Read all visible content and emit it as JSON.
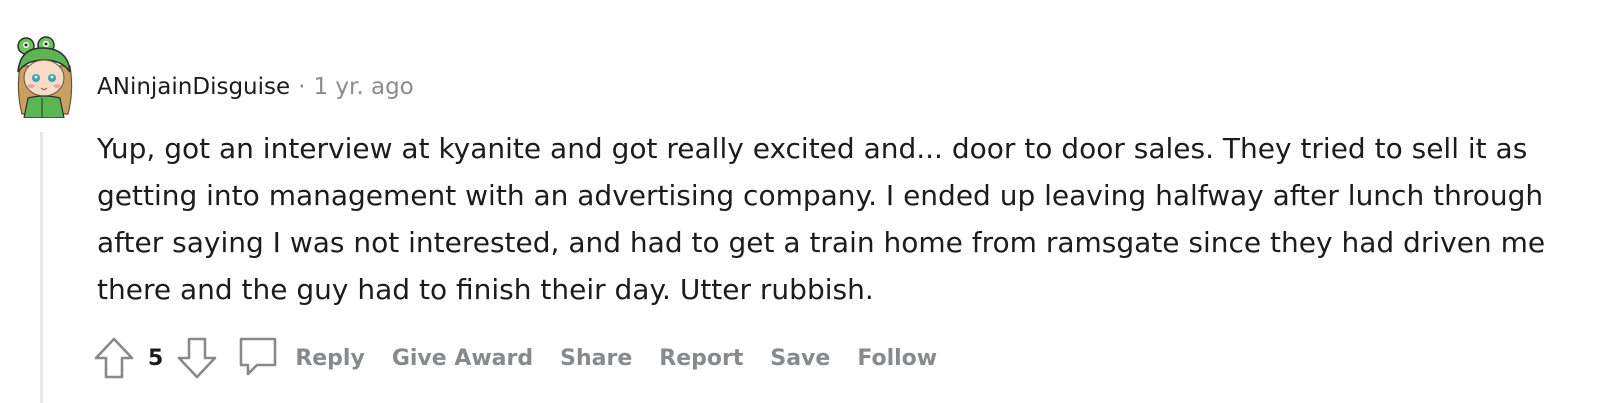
{
  "comment": {
    "author": "ANinjainDisguise",
    "separator": "·",
    "time": "1 yr. ago",
    "body": "Yup, got an interview at kyanite and got really excited and... door to door sales. They tried to sell it as getting into management with an advertising company. I ended up leaving halfway after lunch through after saying I was not interested, and had to get a train home from ramsgate since they had driven me there and the guy had to finish their day. Utter rubbish.",
    "score": "5"
  },
  "actions": {
    "reply": "Reply",
    "give_award": "Give Award",
    "share": "Share",
    "report": "Report",
    "save": "Save",
    "follow": "Follow"
  },
  "icons": {
    "upvote": "arrow-up-outline-icon",
    "downvote": "arrow-down-outline-icon",
    "reply": "speech-bubble-icon"
  },
  "colors": {
    "text": "#1c1c1c",
    "muted": "#878a8c",
    "thread_line": "#e8e8e8",
    "avatar_green": "#5ab552"
  }
}
